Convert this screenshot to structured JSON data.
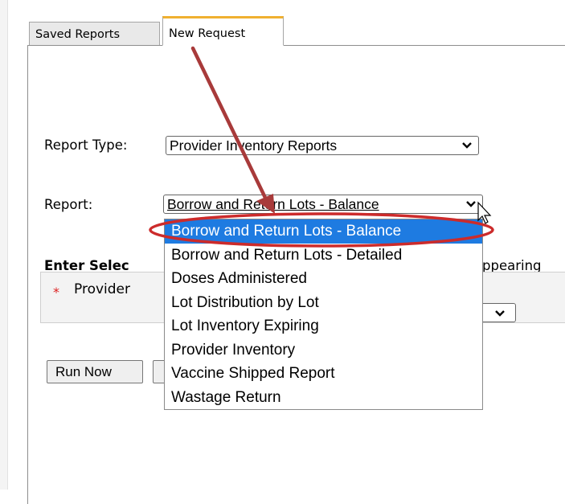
{
  "tabs": {
    "saved_reports": "Saved Reports",
    "new_request": "New Request"
  },
  "form": {
    "report_type_label": "Report Type:",
    "report_type_value": "Provider Inventory Reports",
    "report_label": "Report:",
    "report_value": "Borrow and Return Lots - Balance",
    "enter_heading": "Enter Selec",
    "appearing_fragment": "ppearing",
    "provider_label": "Provider",
    "required_marker": "*"
  },
  "buttons": {
    "run_now": "Run Now"
  },
  "dropdown": {
    "selected_index": 0,
    "options": [
      "Borrow and Return Lots - Balance",
      "Borrow and Return Lots - Detailed",
      "Doses Administered",
      "Lot Distribution by Lot",
      "Lot Inventory Expiring",
      "Provider Inventory",
      "Vaccine Shipped Report",
      "Wastage Return"
    ]
  },
  "colors": {
    "highlight": "#1e7be1",
    "annotation_arrow": "#a83a3a",
    "annotation_ellipse": "#cc2b2b",
    "tab_accent": "#f0b030"
  },
  "icons": {
    "select_arrow": "chevron-down-icon",
    "cursor": "mouse-pointer-icon"
  }
}
